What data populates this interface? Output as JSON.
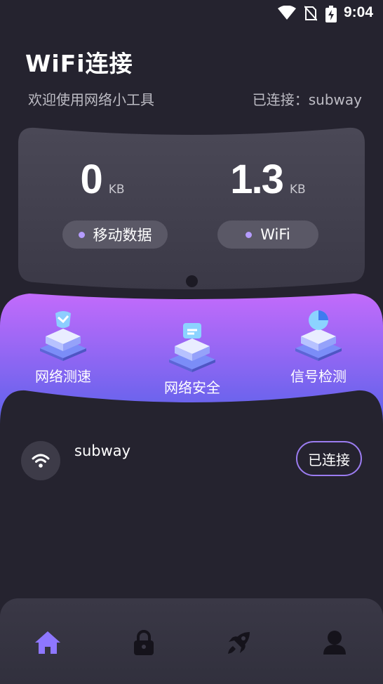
{
  "status_bar": {
    "time": "9:04"
  },
  "header": {
    "title": "WiFi连接",
    "welcome": "欢迎使用网络小工具",
    "connected_text": "已连接：subway"
  },
  "usage": {
    "mobile": {
      "value": "0",
      "unit": "KB",
      "label": "移动数据"
    },
    "wifi": {
      "value": "1.3",
      "unit": "KB",
      "label": "WiFi"
    }
  },
  "tools": [
    {
      "label": "网络测速",
      "icon": "speed-test-icon"
    },
    {
      "label": "网络安全",
      "icon": "network-security-icon"
    },
    {
      "label": "信号检测",
      "icon": "signal-detect-icon"
    }
  ],
  "network_list": [
    {
      "ssid": "subway",
      "action": "已连接"
    }
  ],
  "bottom_nav": [
    {
      "icon": "home-icon",
      "active": true
    },
    {
      "icon": "lock-icon",
      "active": false
    },
    {
      "icon": "rocket-icon",
      "active": false
    },
    {
      "icon": "user-icon",
      "active": false
    }
  ],
  "colors": {
    "background": "#25232f",
    "accent": "#9b7cf0",
    "gradient_start": "#b566ff",
    "gradient_end": "#5d62e8"
  }
}
